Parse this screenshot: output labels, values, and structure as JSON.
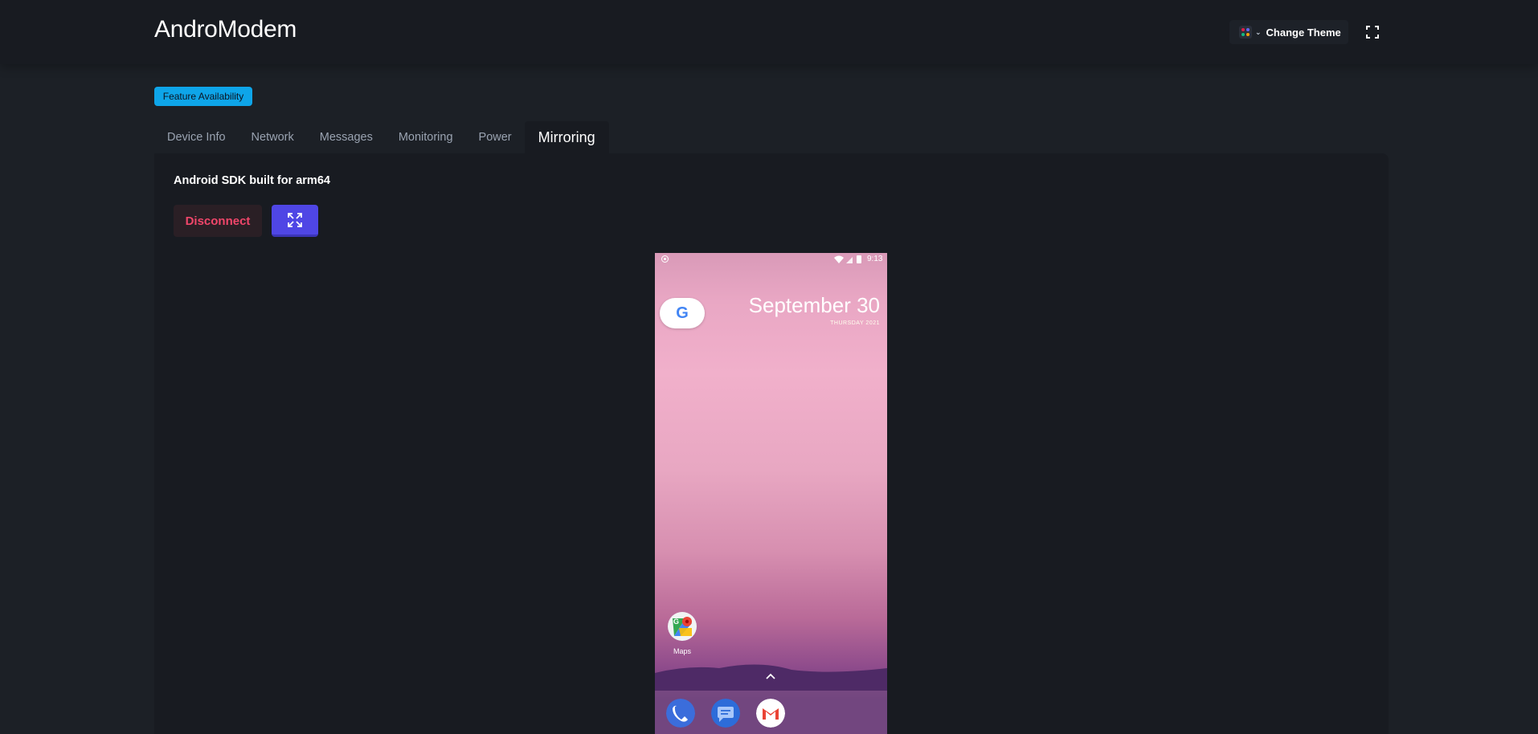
{
  "header": {
    "title": "AndroModem",
    "theme_button_label": "Change Theme",
    "theme_icon": "palette-icon",
    "fullscreen_icon": "fullscreen-icon"
  },
  "badge": {
    "label": "Feature Availability"
  },
  "tabs": [
    {
      "label": "Device Info"
    },
    {
      "label": "Network"
    },
    {
      "label": "Messages"
    },
    {
      "label": "Monitoring"
    },
    {
      "label": "Power"
    },
    {
      "label": "Mirroring",
      "active": true
    }
  ],
  "mirroring": {
    "device_name": "Android SDK built for arm64",
    "disconnect_label": "Disconnect",
    "expand_icon": "expand-icon"
  },
  "phone": {
    "time": "9:13",
    "date": "September 30",
    "date_sub": "THURSDAY 2021",
    "google_letter": "G",
    "maps_label": "Maps",
    "dock_apps": [
      "phone-app-icon",
      "messages-app-icon",
      "gmail-app-icon"
    ]
  },
  "colors": {
    "background": "#1c2026",
    "header": "#181b21",
    "accent_badge": "#0ea5e9",
    "disconnect_text": "#f0466a",
    "expand_button": "#4f46e5"
  }
}
